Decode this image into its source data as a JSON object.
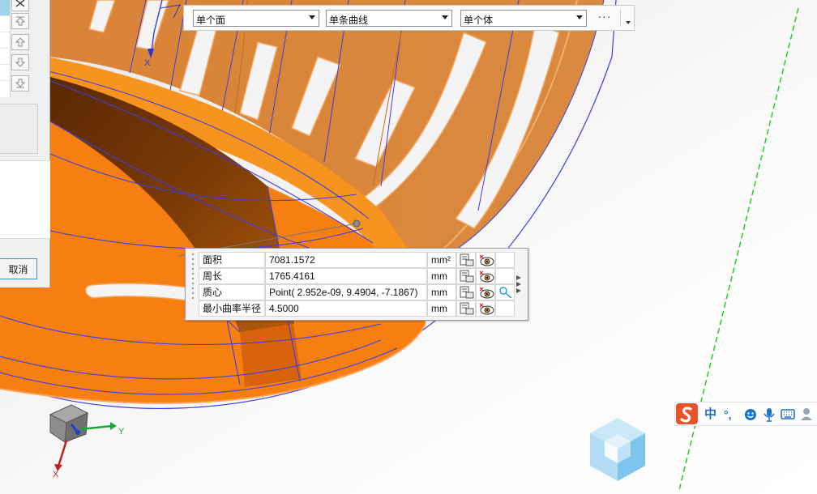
{
  "selection_toolbar": {
    "face_filter": "单个面",
    "curve_filter": "单条曲线",
    "body_filter": "单个体",
    "more_label": "···"
  },
  "dialog": {
    "cancel_label": "取消"
  },
  "measure_panel": {
    "rows": [
      {
        "label": "面积",
        "value": "7081.1572",
        "unit": "mm²"
      },
      {
        "label": "周长",
        "value": "1765.4161",
        "unit": "mm"
      },
      {
        "label": "质心",
        "value": "Point( 2.952e-09, 9.4904, -7.1867)",
        "unit": "mm"
      },
      {
        "label": "最小曲率半径",
        "value": "4.5000",
        "unit": "mm"
      }
    ]
  },
  "axes": {
    "y_label": "Y",
    "x_label": "X",
    "x_top_label": "X"
  },
  "ime": {
    "chinese_mode": "中",
    "punctuation": "°,"
  },
  "colors": {
    "part_orange": "#f77f12",
    "part_dark": "#632e04",
    "edge_blue": "#3b3fe0",
    "datum_green": "#22d01e",
    "panel_bg": "#f4f4f4"
  }
}
